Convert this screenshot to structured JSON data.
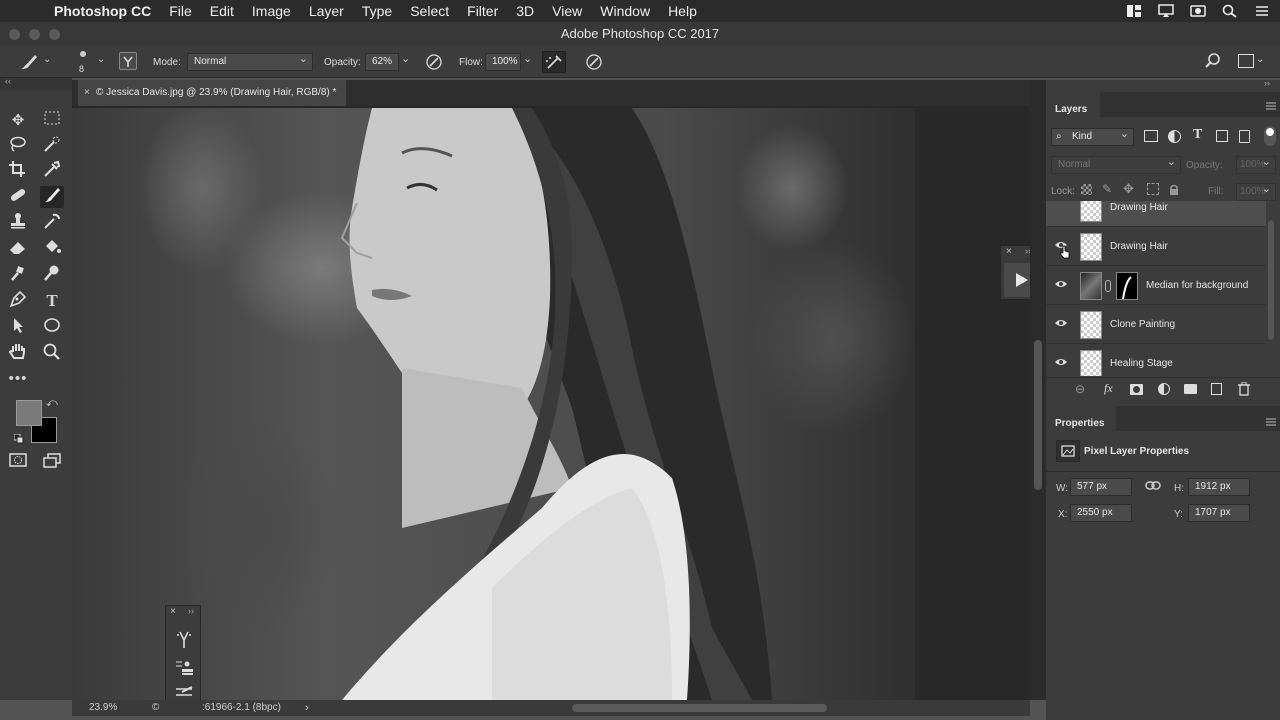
{
  "menubar": {
    "app_name": "Photoshop CC",
    "items": [
      "File",
      "Edit",
      "Image",
      "Layer",
      "Type",
      "Select",
      "Filter",
      "3D",
      "View",
      "Window",
      "Help"
    ]
  },
  "window": {
    "title": "Adobe Photoshop CC 2017"
  },
  "options": {
    "brush_size": "8",
    "mode_label": "Mode:",
    "mode_value": "Normal",
    "opacity_label": "Opacity:",
    "opacity_value": "62%",
    "flow_label": "Flow:",
    "flow_value": "100%"
  },
  "document": {
    "tab_title": "© Jessica Davis.jpg @ 23.9% (Drawing Hair, RGB/8) *",
    "zoom": "23.9%",
    "doc_info": ":61966-2.1 (8bpc)"
  },
  "layers_panel": {
    "title": "Layers",
    "filter_kind": "Kind",
    "blend_mode": "Normal",
    "opacity_label": "Opacity:",
    "opacity_value": "100%",
    "lock_label": "Lock:",
    "fill_label": "Fill:",
    "fill_value": "100%",
    "layers": [
      {
        "name": "Drawing Hair",
        "visible": false
      },
      {
        "name": "Drawing Hair",
        "visible": true
      },
      {
        "name": "Median for background",
        "visible": true
      },
      {
        "name": "Clone Painting",
        "visible": true
      },
      {
        "name": "Healing Stage",
        "visible": true
      }
    ]
  },
  "properties_panel": {
    "title": "Properties",
    "subtitle": "Pixel Layer Properties",
    "w_label": "W:",
    "w_value": "577 px",
    "h_label": "H:",
    "h_value": "1912 px",
    "x_label": "X:",
    "x_value": "2550 px",
    "y_label": "Y:",
    "y_value": "1707 px"
  },
  "colors": {
    "foreground": "#7a7a7a",
    "background": "#000000"
  }
}
